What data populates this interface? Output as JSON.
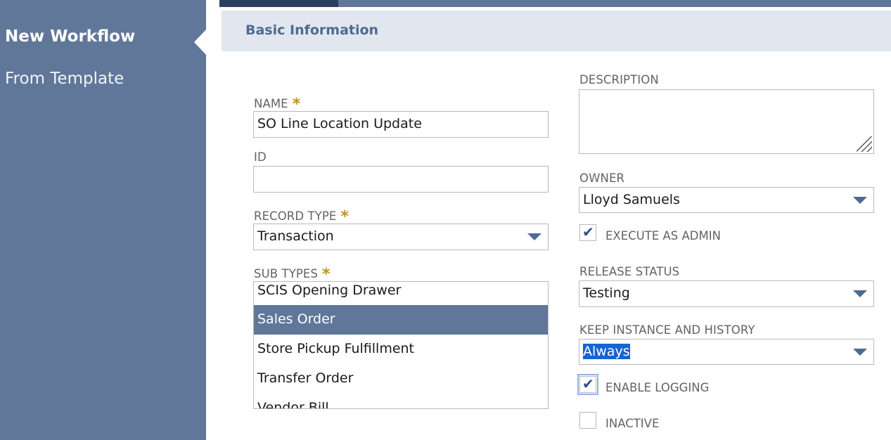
{
  "sidebar": {
    "items": [
      {
        "label": "New Workflow"
      },
      {
        "label": "From Template"
      }
    ]
  },
  "section": {
    "title": "Basic Information"
  },
  "form": {
    "name": {
      "label": "NAME",
      "required": "*",
      "value": "SO Line Location Update"
    },
    "id": {
      "label": "ID",
      "value": ""
    },
    "record_type": {
      "label": "RECORD TYPE",
      "required": "*",
      "value": "Transaction"
    },
    "sub_types": {
      "label": "SUB TYPES",
      "required": "*",
      "options": [
        "SCIS Opening Drawer",
        "Sales Order",
        "Store Pickup Fulfillment",
        "Transfer Order",
        "Vendor Bill"
      ],
      "selected": "Sales Order"
    },
    "description": {
      "label": "DESCRIPTION",
      "value": ""
    },
    "owner": {
      "label": "OWNER",
      "value": "Lloyd Samuels"
    },
    "execute_as_admin": {
      "label": "EXECUTE AS ADMIN",
      "checked": true
    },
    "release_status": {
      "label": "RELEASE STATUS",
      "value": "Testing"
    },
    "keep_instance": {
      "label": "KEEP INSTANCE AND HISTORY",
      "value": "Always"
    },
    "enable_logging": {
      "label": "ENABLE LOGGING",
      "checked": true
    },
    "inactive": {
      "label": "INACTIVE",
      "checked": false
    }
  },
  "icons": {
    "checkmark": "✔",
    "dropdown": "chevron-down-icon"
  },
  "colors": {
    "sidebar": "#607799",
    "header": "#e1e6ef",
    "required": "#c4901c",
    "selection": "#607799"
  }
}
